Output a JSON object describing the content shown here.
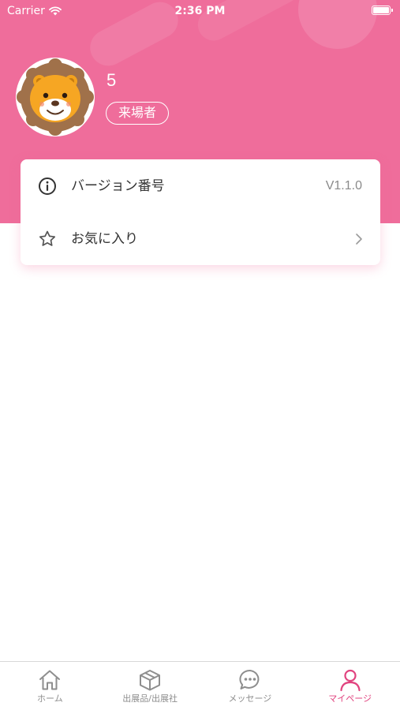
{
  "status_bar": {
    "carrier": "Carrier",
    "time": "2:36 PM"
  },
  "profile": {
    "name": "5",
    "role": "来場者"
  },
  "menu": [
    {
      "label": "バージョン番号",
      "value": "V1.1.0",
      "icon": "info-icon"
    },
    {
      "label": "お気に入り",
      "value": "",
      "icon": "star-icon"
    }
  ],
  "tabs": [
    {
      "label": "ホーム",
      "icon": "home-icon",
      "active": false
    },
    {
      "label": "出展品/出展社",
      "icon": "box-icon",
      "active": false
    },
    {
      "label": "メッセージ",
      "icon": "chat-icon",
      "active": false
    },
    {
      "label": "マイページ",
      "icon": "person-icon",
      "active": true
    }
  ],
  "colors": {
    "brand_pink": "#ef6d9b",
    "active_tab": "#e1437f"
  }
}
